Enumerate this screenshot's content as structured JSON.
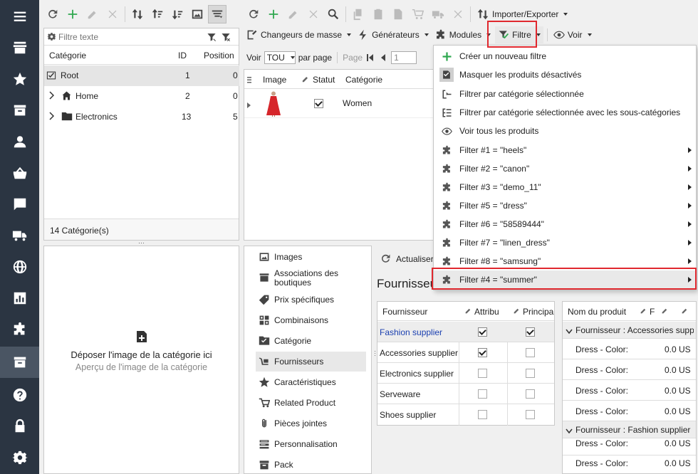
{
  "sidebar": {
    "items": [
      {
        "icon": "hamburger-menu-icon"
      },
      {
        "icon": "store-icon"
      },
      {
        "icon": "star-icon"
      },
      {
        "icon": "inbox-icon"
      },
      {
        "icon": "user-icon"
      },
      {
        "icon": "basket-icon"
      },
      {
        "icon": "message-icon"
      },
      {
        "icon": "truck-icon"
      },
      {
        "icon": "globe-icon"
      },
      {
        "icon": "bar-chart-icon"
      },
      {
        "icon": "puzzle-icon"
      },
      {
        "icon": "catalog-icon"
      },
      {
        "icon": "help-icon"
      },
      {
        "icon": "lock-icon"
      },
      {
        "icon": "settings-icon"
      }
    ]
  },
  "category_panel": {
    "filter_placeholder": "Filtre texte",
    "columns": {
      "category": "Catégorie",
      "id": "ID",
      "position": "Position"
    },
    "rows": [
      {
        "name": "Root",
        "id": "1",
        "position": "0"
      },
      {
        "name": "Home",
        "id": "2",
        "position": "0"
      },
      {
        "name": "Electronics",
        "id": "13",
        "position": "5"
      }
    ],
    "footer": "14 Catégorie(s)"
  },
  "image_panel": {
    "drop_text": "Déposer l'image de la catégorie ici",
    "preview_text": "Aperçu de l'image de la catégorie"
  },
  "product_toolbar": {
    "import_export": "Importer/Exporter",
    "mass_changers": "Changeurs de masse",
    "generators": "Générateurs",
    "modules": "Modules",
    "filter": "Filtre",
    "view": "Voir"
  },
  "paging": {
    "show_label": "Voir",
    "per_page_value": "TOU",
    "per_page_label": "par page",
    "page_label": "Page",
    "page_value": "1"
  },
  "product_grid": {
    "columns": {
      "image": "Image",
      "status": "Statut",
      "category": "Catégorie"
    },
    "rows": [
      {
        "category": "Women",
        "status_checked": true
      }
    ]
  },
  "filter_menu": {
    "items": [
      {
        "label": "Créer un nouveau filtre",
        "icon": "plus-icon",
        "submenu": false
      },
      {
        "label": "Masquer les produits désactivés",
        "icon": "hide-disabled-icon",
        "submenu": false
      },
      {
        "label": "Filtrer par catégorie sélectionnée",
        "icon": "category-filter-icon",
        "submenu": false
      },
      {
        "label": "Filtrer par catégorie sélectionnée avec les sous-catégories",
        "icon": "subcategory-filter-icon",
        "submenu": false
      },
      {
        "label": "Voir tous les produits",
        "icon": "eye-icon",
        "submenu": false
      },
      {
        "label": "Filter #1 = \"heels\"",
        "icon": "puzzle-icon",
        "submenu": true
      },
      {
        "label": "Filter #2 = \"canon\"",
        "icon": "puzzle-icon",
        "submenu": true
      },
      {
        "label": "Filter #3 = \"demo_11\"",
        "icon": "puzzle-icon",
        "submenu": true
      },
      {
        "label": "Filter #5 = \"dress\"",
        "icon": "puzzle-icon",
        "submenu": true
      },
      {
        "label": "Filter #6 = \"58589444\"",
        "icon": "puzzle-icon",
        "submenu": true
      },
      {
        "label": "Filter #7 = \"linen_dress\"",
        "icon": "puzzle-icon",
        "submenu": true
      },
      {
        "label": "Filter #8 = \"samsung\"",
        "icon": "puzzle-icon",
        "submenu": true
      },
      {
        "label": "Filter #4 = \"summer\"",
        "icon": "puzzle-icon",
        "submenu": true
      }
    ]
  },
  "detail_tabs": {
    "items": [
      {
        "label": "Images",
        "icon": "images-icon"
      },
      {
        "label": "Associations des boutiques",
        "icon": "shop-association-icon"
      },
      {
        "label": "Prix spécifiques",
        "icon": "price-tag-icon"
      },
      {
        "label": "Combinaisons",
        "icon": "combinations-icon"
      },
      {
        "label": "Catégorie",
        "icon": "folder-check-icon"
      },
      {
        "label": "Fournisseurs",
        "icon": "supplier-icon"
      },
      {
        "label": "Caractéristiques",
        "icon": "features-icon"
      },
      {
        "label": "Related Product",
        "icon": "related-icon"
      },
      {
        "label": "Pièces jointes",
        "icon": "attachment-icon"
      },
      {
        "label": "Personnalisation",
        "icon": "customization-icon"
      },
      {
        "label": "Pack",
        "icon": "pack-icon"
      }
    ]
  },
  "suppliers": {
    "refresh_label": "Actualiser",
    "title": "Fournisseurs",
    "columns": {
      "supplier": "Fournisseur",
      "attributes": "Attribu",
      "principal": "Principa"
    },
    "rows": [
      {
        "name": "Fashion supplier",
        "attr": true,
        "principal": true,
        "highlight": true
      },
      {
        "name": "Accessories supplier",
        "attr": true,
        "principal": false,
        "highlight": false
      },
      {
        "name": "Electronics supplier",
        "attr": false,
        "principal": false,
        "highlight": false
      },
      {
        "name": "Serveware",
        "attr": false,
        "principal": false,
        "highlight": false
      },
      {
        "name": "Shoes supplier",
        "attr": false,
        "principal": false,
        "highlight": false
      }
    ]
  },
  "supplier_products": {
    "column_name": "Nom du produit",
    "column_extra": "F",
    "groups": [
      {
        "label": "Fournisseur : Accessories suppl",
        "rows": [
          {
            "name": "Dress - Color:",
            "price": "0.0 US"
          },
          {
            "name": "Dress - Color:",
            "price": "0.0 US"
          },
          {
            "name": "Dress - Color:",
            "price": "0.0 US"
          },
          {
            "name": "Dress - Color:",
            "price": "0.0 US"
          }
        ]
      },
      {
        "label": "Fournisseur : Fashion supplier",
        "rows": [
          {
            "name": "Dress - Color:",
            "price": "0.0 US"
          },
          {
            "name": "Dress - Color:",
            "price": "0.0 US"
          }
        ]
      }
    ]
  },
  "colors": {
    "sidebar": "#2b3542",
    "highlight_red": "#e0282e",
    "link_blue": "#1a3fb0",
    "green_plus": "#2fa84f"
  }
}
